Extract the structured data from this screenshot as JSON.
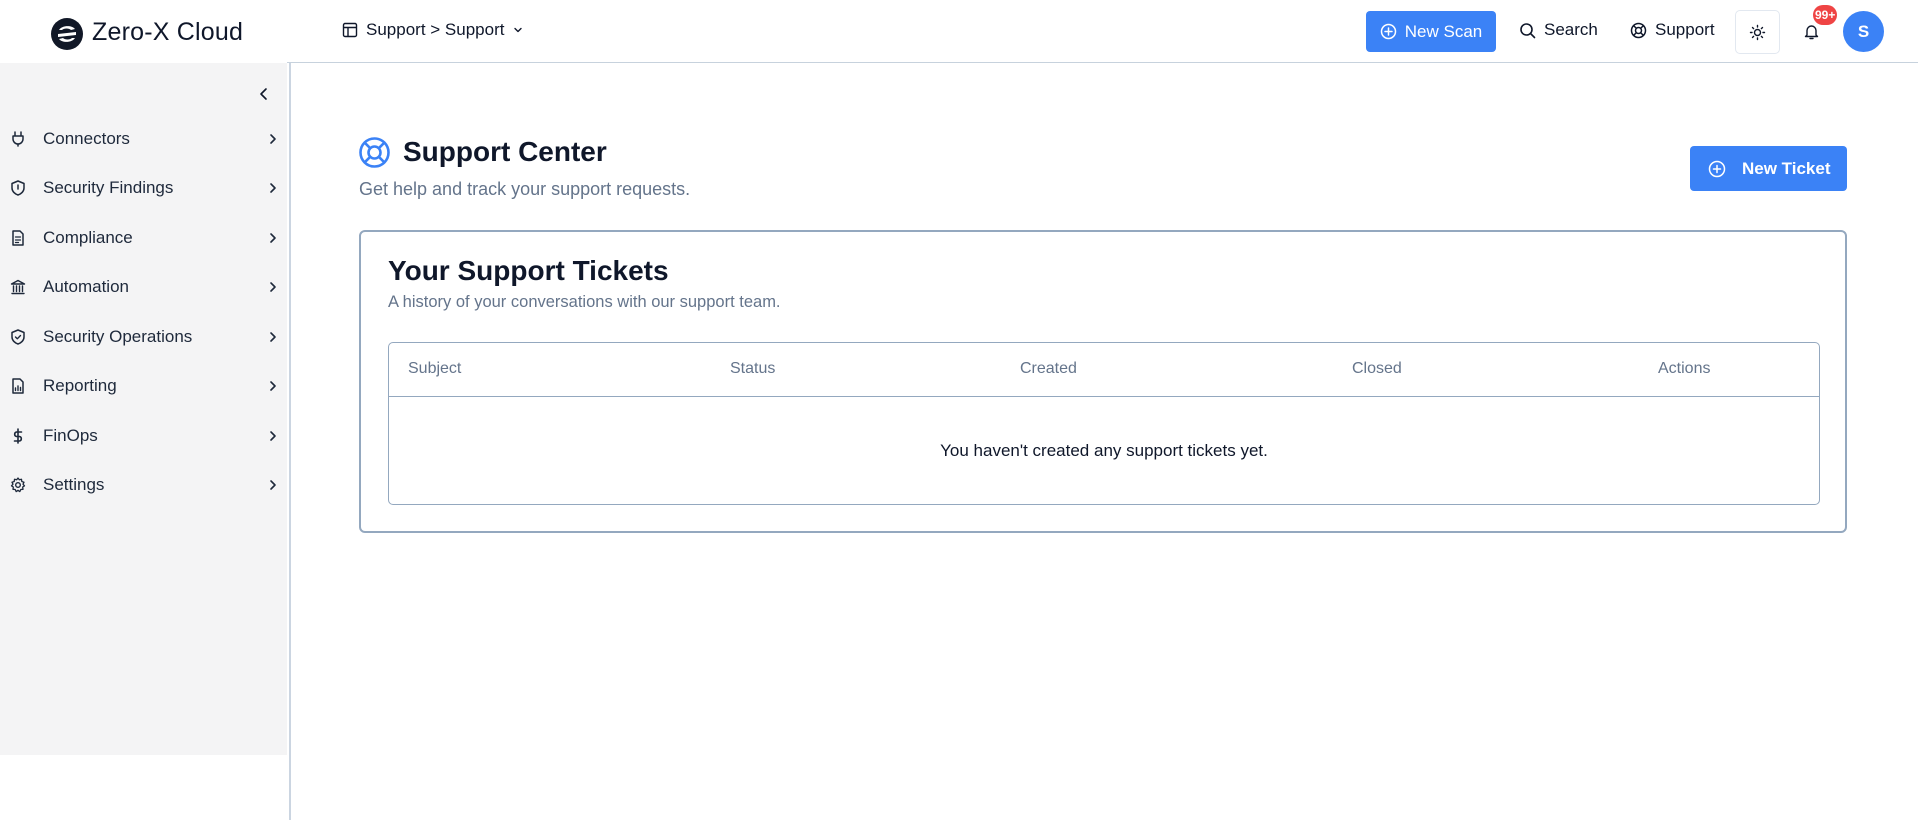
{
  "brand": {
    "name": "Zero-X Cloud"
  },
  "sidebar": {
    "items": [
      {
        "label": "Connectors",
        "icon": "plug-icon"
      },
      {
        "label": "Security Findings",
        "icon": "shield-icon"
      },
      {
        "label": "Compliance",
        "icon": "document-icon"
      },
      {
        "label": "Automation",
        "icon": "bank-icon"
      },
      {
        "label": "Security Operations",
        "icon": "shield-check-icon"
      },
      {
        "label": "Reporting",
        "icon": "report-icon"
      },
      {
        "label": "FinOps",
        "icon": "dollar-icon"
      },
      {
        "label": "Settings",
        "icon": "gear-icon"
      }
    ]
  },
  "header": {
    "breadcrumb": "Support > Support",
    "new_scan_label": "New Scan",
    "search_label": "Search",
    "support_label": "Support",
    "notification_badge": "99+",
    "avatar_initial": "S"
  },
  "main": {
    "title": "Support Center",
    "subtitle": "Get help and track your support requests.",
    "new_ticket_label": "New Ticket",
    "card": {
      "title": "Your Support Tickets",
      "subtitle": "A history of your conversations with our support team.",
      "columns": [
        "Subject",
        "Status",
        "Created",
        "Closed",
        "Actions"
      ],
      "empty_message": "You haven't created any support tickets yet."
    }
  },
  "colors": {
    "accent": "#3b82f6",
    "badge": "#ef4444",
    "sidebar_bg": "#f4f4f5",
    "muted_text": "#64748b",
    "border": "#94a8bf"
  }
}
